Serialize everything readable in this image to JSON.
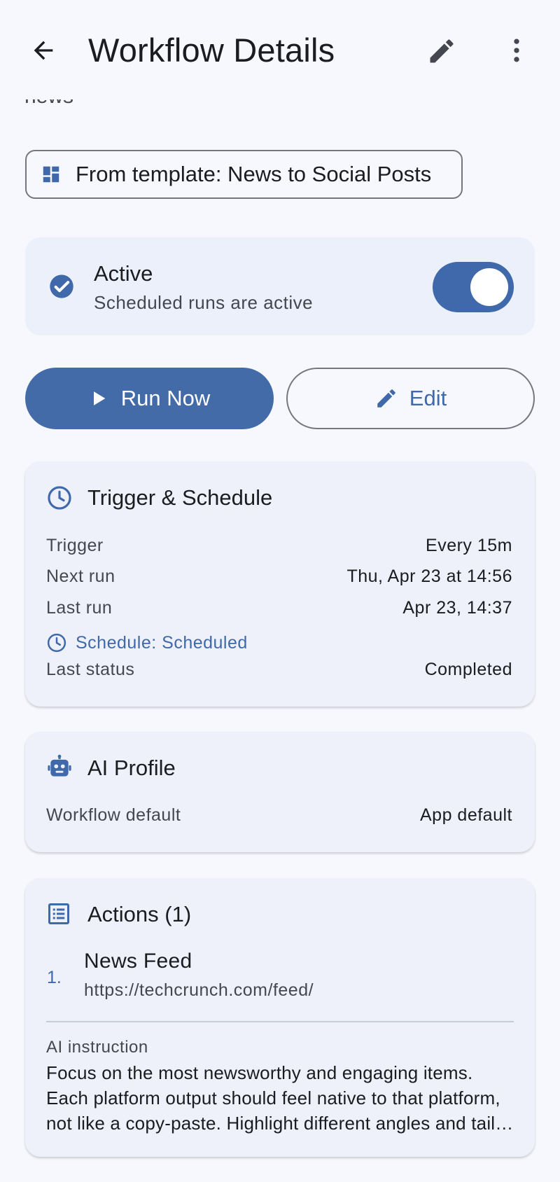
{
  "appbar": {
    "title": "Workflow Details"
  },
  "scrolled_text": "news",
  "template_chip": {
    "label": "From template: News to Social Posts"
  },
  "active_card": {
    "title": "Active",
    "subtitle": "Scheduled runs are active",
    "toggle_on": true
  },
  "buttons": {
    "run_now": "Run Now",
    "edit": "Edit"
  },
  "trigger_card": {
    "title": "Trigger & Schedule",
    "rows": [
      {
        "label": "Trigger",
        "value": "Every 15m"
      },
      {
        "label": "Next run",
        "value": "Thu, Apr 23 at 14:56"
      },
      {
        "label": "Last run",
        "value": "Apr 23, 14:37"
      }
    ],
    "schedule_link": "Schedule: Scheduled",
    "last_status": {
      "label": "Last status",
      "value": "Completed"
    }
  },
  "ai_card": {
    "title": "AI Profile",
    "row": {
      "label": "Workflow default",
      "value": "App default"
    }
  },
  "actions_card": {
    "title": "Actions (1)",
    "items": [
      {
        "number": "1.",
        "title": "News Feed",
        "url": "https://techcrunch.com/feed/"
      }
    ],
    "ai_instruction_label": "AI instruction",
    "ai_instruction_text": "Focus on the most newsworthy and engaging items. Each platform output should feel native to that platform, not like a copy-paste. Highlight different angles and tailor the tone for each audience."
  },
  "colors": {
    "accent": "#3f69aa",
    "background": "#f6f8fd",
    "card": "#eef1f9"
  }
}
